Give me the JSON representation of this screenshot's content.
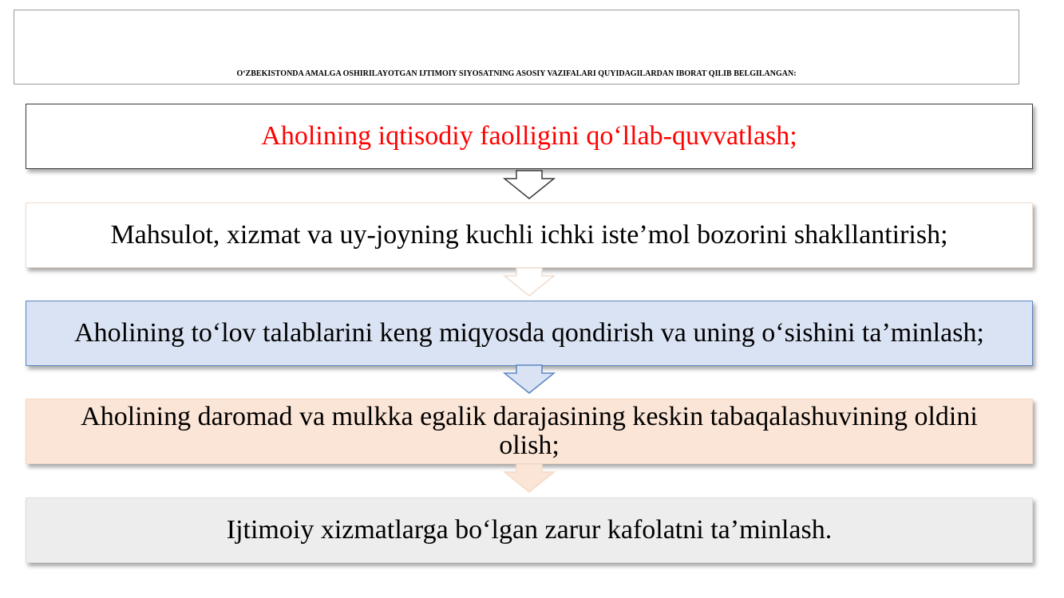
{
  "title": "O‘ZBEKISTONDA AMALGA OSHIRILAYOTGAN IJTIMOIY SIYOSATNING ASOSIY VAZIFALARI QUYIDAGILARDAN IBORAT QILIB BELGILANGAN:",
  "steps": [
    {
      "text": "Aholining iqtisodiy faolligini qo‘llab-quvvatlash;",
      "text_color": "#ff0000",
      "fill": "#ffffff",
      "border": "#3a3a3a"
    },
    {
      "text": "Mahsulot, xizmat va uy-joyning kuchli ichki iste’mol bozorini shakllantirish;",
      "text_color": "#000000",
      "fill": "#ffffff",
      "border": "#f0ddd0"
    },
    {
      "text": "Aholining to‘lov talablarini keng miqyosda qondirish va uning o‘sishini ta’minlash;",
      "text_color": "#000000",
      "fill": "#dae3f3",
      "border": "#5b84c4"
    },
    {
      "text": "Aholining daromad va mulkka egalik darajasining keskin tabaqalashuvining oldini olish;",
      "text_color": "#000000",
      "fill": "#fbe5d6",
      "border": "#f3d9c5"
    },
    {
      "text": "Ijtimoiy xizmatlarga bo‘lgan zarur kafolatni ta’minlash.",
      "text_color": "#000000",
      "fill": "#ededed",
      "border": "#dedede"
    }
  ],
  "arrows": [
    {
      "icon": "down-arrow-icon",
      "fill": "#ffffff",
      "stroke": "#3a3a3a"
    },
    {
      "icon": "down-arrow-icon",
      "fill": "#ffffff",
      "stroke": "#f0ddd0"
    },
    {
      "icon": "down-arrow-icon",
      "fill": "#dae3f3",
      "stroke": "#5b84c4"
    },
    {
      "icon": "down-arrow-icon",
      "fill": "#fbe5d6",
      "stroke": "#f3d9c5"
    }
  ]
}
